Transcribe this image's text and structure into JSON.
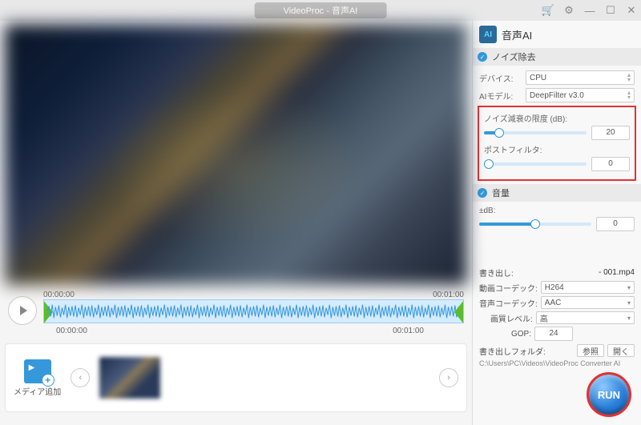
{
  "title": "VideoProc - 音声AI",
  "panel": {
    "title": "音声AI",
    "noise_removal": "ノイズ除去",
    "device_label": "デバイス:",
    "device_value": "CPU",
    "model_label": "AIモデル:",
    "model_value": "DeepFilter v3.0",
    "limit_label": "ノイズ減衰の限度 (dB):",
    "limit_value": "20",
    "postfilter_label": "ポストフィルタ:",
    "postfilter_value": "0",
    "volume": "音量",
    "db_label": "±dB:",
    "db_value": "0",
    "output_label": "書き出し:",
    "output_file": "- 001.mp4",
    "vcodec_label": "動画コーデック:",
    "vcodec_value": "H264",
    "acodec_label": "音声コーデック:",
    "acodec_value": "AAC",
    "quality_label": "画質レベル:",
    "quality_value": "高",
    "gop_label": "GOP:",
    "gop_value": "24",
    "folder_label": "書き出しフォルダ:",
    "browse": "参照",
    "open": "開く",
    "folder_path": "C:\\Users\\PC\\Videos\\VideoProc Converter AI"
  },
  "timeline": {
    "start": "00:00:00",
    "end": "00:01:00"
  },
  "media": {
    "add_label": "メディア追加"
  },
  "run": "RUN"
}
